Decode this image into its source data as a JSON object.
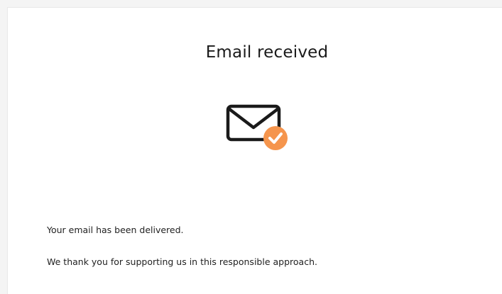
{
  "confirmation": {
    "title": "Email received",
    "icon": "envelope-check-icon",
    "messages": [
      "Your email has been delivered.",
      "We thank you for supporting us in this responsible approach."
    ]
  },
  "colors": {
    "accent": "#f5954d",
    "text": "#1a1a1a"
  }
}
